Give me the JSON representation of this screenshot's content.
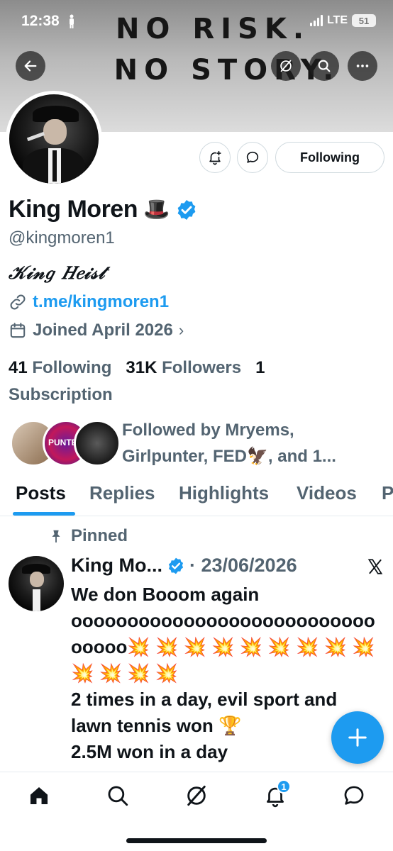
{
  "status_bar": {
    "time": "12:38",
    "network": "LTE",
    "battery": "51"
  },
  "banner": {
    "line1": "NO RISK.",
    "line2": "NO STORY."
  },
  "header_buttons": [
    "back-icon",
    "grok-icon",
    "search-icon",
    "more-icon"
  ],
  "profile": {
    "name": "King Moren",
    "name_emoji": "🎩",
    "handle": "@kingmoren1",
    "bio": "𝒦𝒾𝓃𝑔 𝐻𝑒𝒾𝓈𝓉",
    "link": "t.me/kingmoren1",
    "joined": "Joined April 2026",
    "following_count": "41",
    "following_label": "Following",
    "followers_count": "31K",
    "followers_label": "Followers",
    "subscription_count": "1",
    "subscription_label": "Subscription",
    "followed_by": "Followed by Mryems, Girlpunter, FED🦅, and 1..."
  },
  "actions": {
    "following_button": "Following"
  },
  "tabs": [
    "Posts",
    "Replies",
    "Highlights",
    "Videos",
    "P"
  ],
  "post": {
    "pinned_label": "Pinned",
    "author": "King Mo...",
    "date": "· 23/06/2026",
    "body": "We don Booom again oooooooooooooooooooooooooooooooo💥 💥 💥 💥 💥 💥 💥 💥 💥 💥 💥 💥 💥\n2 times in a day, evil sport and lawn tennis won 🏆\n2.5M won in a day"
  },
  "followed_by_avatar_text": "PUNTER",
  "bottom_nav": {
    "notifications_badge": "1"
  },
  "colors": {
    "accent": "#1d9bf0",
    "secondary_text": "#536471",
    "primary_text": "#0f1419"
  }
}
